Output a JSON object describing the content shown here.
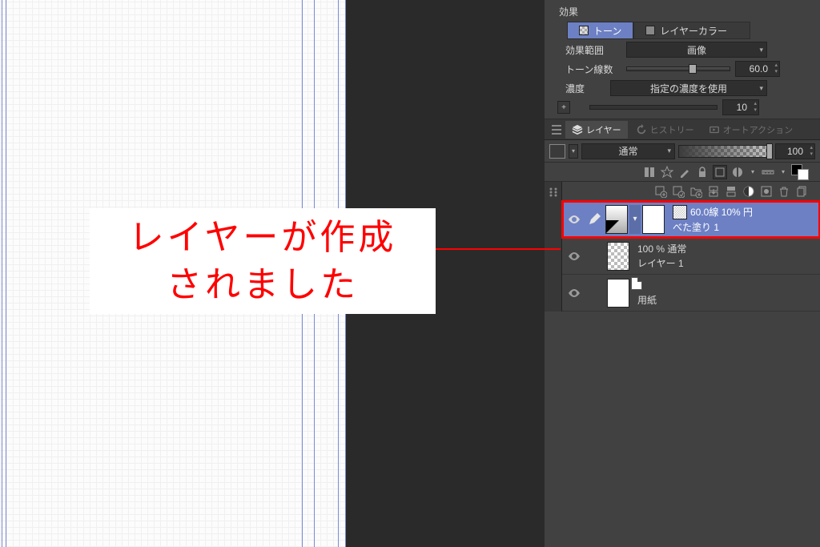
{
  "effects": {
    "header": "効果",
    "tab_tone": "トーン",
    "tab_layercolor": "レイヤーカラー",
    "range_label": "効果範囲",
    "range_value": "画像",
    "lines_label": "トーン線数",
    "lines_value": "60.0",
    "density_label": "濃度",
    "density_value": "指定の濃度を使用",
    "angle_value": "10"
  },
  "panel_tabs": {
    "layer": "レイヤー",
    "history": "ヒストリー",
    "autoaction": "オートアクション"
  },
  "blend": {
    "mode": "通常",
    "opacity": "100"
  },
  "layers": [
    {
      "tone_info": "60.0線 10% 円",
      "name": "べた塗り 1"
    },
    {
      "opacity_mode": "100 % 通常",
      "name": "レイヤー 1"
    },
    {
      "name": "用紙"
    }
  ],
  "annotation": {
    "line1": "レイヤーが作成",
    "line2": "されました"
  }
}
